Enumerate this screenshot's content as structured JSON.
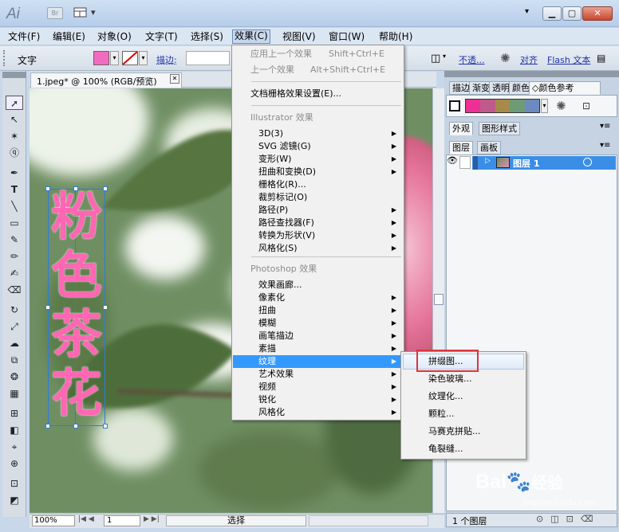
{
  "app": {
    "logo": "Ai",
    "bridge": "Br",
    "ws_arrow": "▾",
    "win_min": "▁",
    "win_max": "▢",
    "win_close": "✕"
  },
  "menubar": [
    "文件(F)",
    "编辑(E)",
    "对象(O)",
    "文字(T)",
    "选择(S)",
    "效果(C)",
    "视图(V)",
    "窗口(W)",
    "帮助(H)"
  ],
  "control": {
    "label": "文字",
    "stroke_label": "描边:",
    "opacity_link": "不透...",
    "align_link": "对齐",
    "flash_link": "Flash 文本"
  },
  "document_tab": {
    "title": "1.jpeg* @ 100% (RGB/预览)",
    "close": "✕"
  },
  "artwork_text": [
    "粉",
    "色",
    "茶",
    "花"
  ],
  "effect_menu": {
    "apply_last": {
      "label": "应用上一个效果",
      "shortcut": "Shift+Ctrl+E"
    },
    "last": {
      "label": "上一个效果",
      "shortcut": "Alt+Shift+Ctrl+E"
    },
    "raster_settings": "文档栅格效果设置(E)...",
    "illustrator_header": "Illustrator 效果",
    "illustrator_items": [
      {
        "label": "3D(3)",
        "sub": true
      },
      {
        "label": "SVG 滤镜(G)",
        "sub": true
      },
      {
        "label": "变形(W)",
        "sub": true
      },
      {
        "label": "扭曲和变换(D)",
        "sub": true
      },
      {
        "label": "栅格化(R)...",
        "sub": false
      },
      {
        "label": "裁剪标记(O)",
        "sub": false
      },
      {
        "label": "路径(P)",
        "sub": true
      },
      {
        "label": "路径查找器(F)",
        "sub": true
      },
      {
        "label": "转换为形状(V)",
        "sub": true
      },
      {
        "label": "风格化(S)",
        "sub": true
      }
    ],
    "photoshop_header": "Photoshop 效果",
    "photoshop_items": [
      {
        "label": "效果画廊...",
        "sub": false
      },
      {
        "label": "像素化",
        "sub": true
      },
      {
        "label": "扭曲",
        "sub": true
      },
      {
        "label": "模糊",
        "sub": true
      },
      {
        "label": "画笔描边",
        "sub": true
      },
      {
        "label": "素描",
        "sub": true
      },
      {
        "label": "纹理",
        "sub": true,
        "highlighted": true
      },
      {
        "label": "艺术效果",
        "sub": true
      },
      {
        "label": "视频",
        "sub": true
      },
      {
        "label": "锐化",
        "sub": true
      },
      {
        "label": "风格化",
        "sub": true
      }
    ]
  },
  "texture_submenu": [
    "拼缀图...",
    "染色玻璃...",
    "纹理化...",
    "颗粒...",
    "马赛克拼贴...",
    "龟裂缝..."
  ],
  "panels": {
    "top_tabs": [
      "描边",
      "渐变",
      "透明",
      "颜色",
      "颜色参考"
    ],
    "appearance_tabs": [
      "外观",
      "图形样式"
    ],
    "layers_tabs": [
      "图层",
      "画板"
    ],
    "layer_name": "图层 1",
    "layer_count": "1 个图层",
    "swatches": [
      "#ee2f93",
      "#c05a8b",
      "#a58a4a",
      "#6f9a76",
      "#6a8ac0"
    ]
  },
  "status": {
    "zoom": "100%",
    "page": "1",
    "tool": "选择"
  },
  "watermark": {
    "brand": "Bai",
    "brand2": "经验",
    "url": "jingyan.baidu.com"
  },
  "colors": {
    "accent": "#3399ff",
    "text_pink": "#ff66b3",
    "fill_swatch": "#f26bc0"
  }
}
